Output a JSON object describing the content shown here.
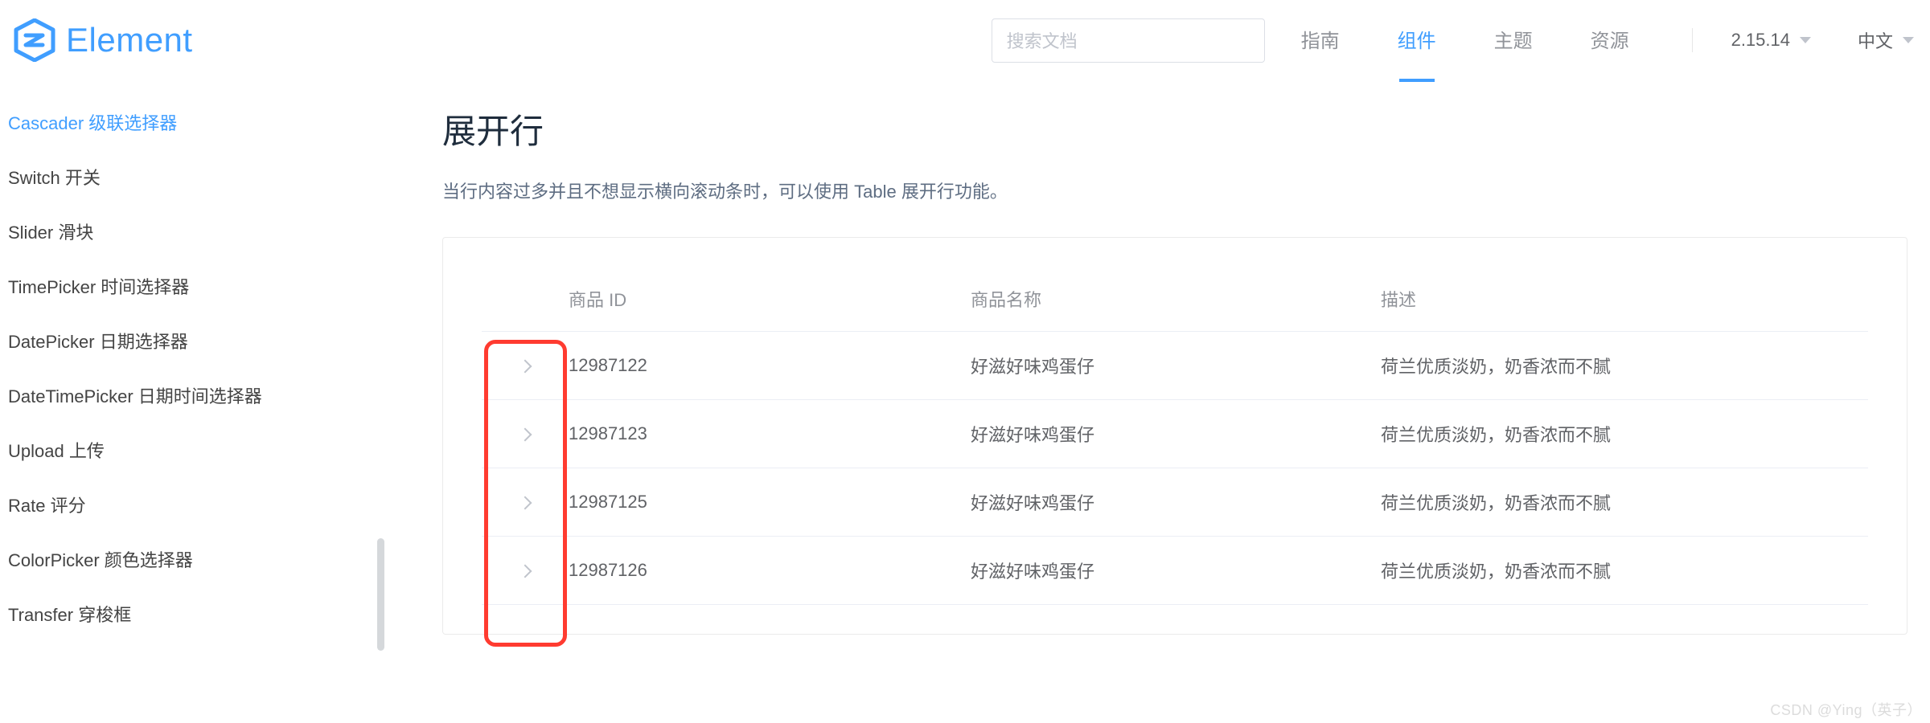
{
  "brand": "Element",
  "search": {
    "placeholder": "搜索文档"
  },
  "nav": {
    "guide": "指南",
    "component": "组件",
    "theme": "主题",
    "resource": "资源",
    "active": "component"
  },
  "version": "2.15.14",
  "language": "中文",
  "sidebar": {
    "items": [
      {
        "label": "Cascader 级联选择器",
        "active": true
      },
      {
        "label": "Switch 开关"
      },
      {
        "label": "Slider 滑块"
      },
      {
        "label": "TimePicker 时间选择器"
      },
      {
        "label": "DatePicker 日期选择器"
      },
      {
        "label": "DateTimePicker 日期时间选择器"
      },
      {
        "label": "Upload 上传"
      },
      {
        "label": "Rate 评分"
      },
      {
        "label": "ColorPicker 颜色选择器"
      },
      {
        "label": "Transfer 穿梭框"
      }
    ]
  },
  "page": {
    "title": "展开行",
    "desc": "当行内容过多并且不想显示横向滚动条时，可以使用 Table 展开行功能。"
  },
  "table": {
    "headers": {
      "id": "商品 ID",
      "name": "商品名称",
      "desc": "描述"
    },
    "rows": [
      {
        "id": "12987122",
        "name": "好滋好味鸡蛋仔",
        "desc": "荷兰优质淡奶，奶香浓而不腻"
      },
      {
        "id": "12987123",
        "name": "好滋好味鸡蛋仔",
        "desc": "荷兰优质淡奶，奶香浓而不腻"
      },
      {
        "id": "12987125",
        "name": "好滋好味鸡蛋仔",
        "desc": "荷兰优质淡奶，奶香浓而不腻"
      },
      {
        "id": "12987126",
        "name": "好滋好味鸡蛋仔",
        "desc": "荷兰优质淡奶，奶香浓而不腻"
      }
    ]
  },
  "watermark": "CSDN @Ying（英子）"
}
